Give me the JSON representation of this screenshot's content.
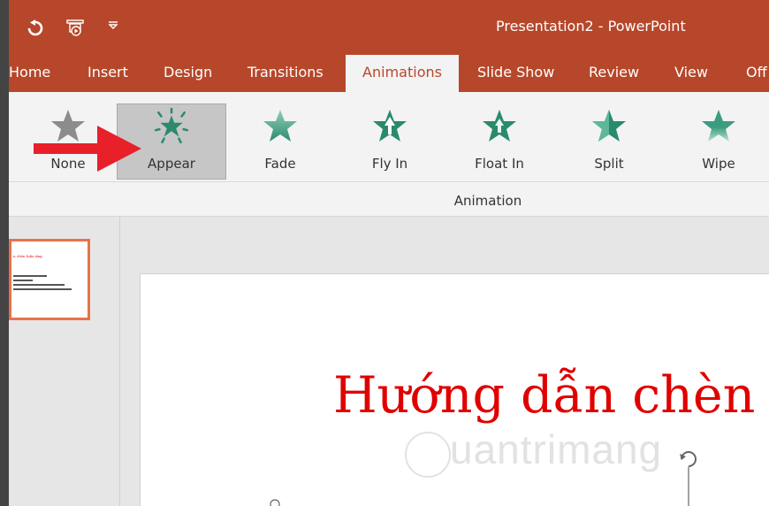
{
  "window": {
    "title": "Presentation2  -  PowerPoint",
    "accent": "#b7472a"
  },
  "quick_access": {
    "undo_icon": "undo-icon",
    "presentation_icon": "start-from-beginning-icon",
    "customize_icon": "customize-qat-icon"
  },
  "tabs": [
    {
      "label": "Home"
    },
    {
      "label": "Insert"
    },
    {
      "label": "Design"
    },
    {
      "label": "Transitions"
    },
    {
      "label": "Animations"
    },
    {
      "label": "Slide Show"
    },
    {
      "label": "Review"
    },
    {
      "label": "View"
    },
    {
      "label": "Off"
    }
  ],
  "active_tab": "Animations",
  "animations": [
    {
      "label": "None",
      "icon": "star-gray-icon"
    },
    {
      "label": "Appear",
      "icon": "star-burst-icon",
      "selected": true
    },
    {
      "label": "Fade",
      "icon": "star-fade-icon"
    },
    {
      "label": "Fly In",
      "icon": "star-fly-in-icon"
    },
    {
      "label": "Float In",
      "icon": "star-float-in-icon"
    },
    {
      "label": "Split",
      "icon": "star-split-icon"
    },
    {
      "label": "Wipe",
      "icon": "star-wipe-icon"
    }
  ],
  "group_label": "Animation",
  "slide": {
    "title": "Hướng dẫn chèn h",
    "watermark": "uantrimang"
  },
  "thumbnail": {
    "title": "n chèn hiệu ứng"
  },
  "highlight_color": "#e8202a"
}
